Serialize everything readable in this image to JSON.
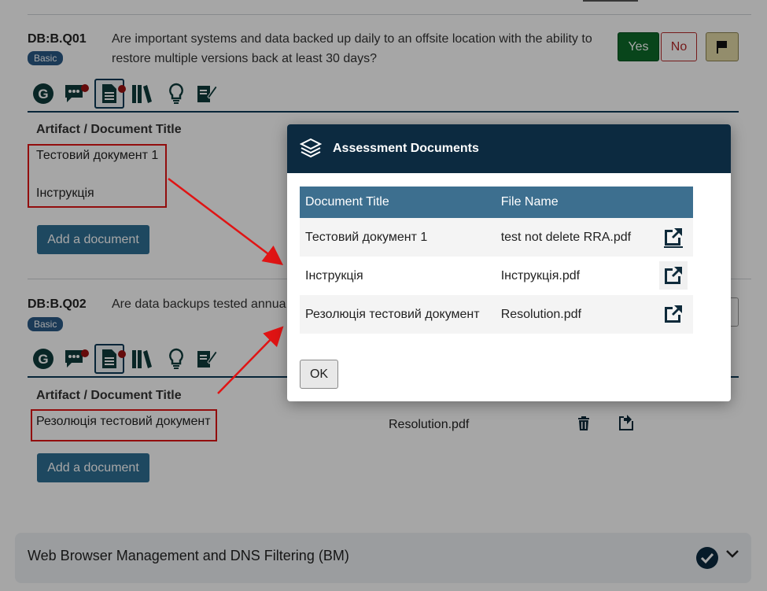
{
  "q1": {
    "id": "DB:B.Q01",
    "badge": "Basic",
    "text_line1": "Are important systems and data backed up daily to an offsite location with the ability to",
    "text_line2": "restore multiple versions back at least 30 days?",
    "yes_label": "Yes",
    "no_label": "No",
    "artifact_header": "Artifact / Document Title",
    "documents": [
      "Тестовий документ 1",
      "Інструкція"
    ],
    "add_label": "Add a document"
  },
  "q2": {
    "id": "DB:B.Q02",
    "badge": "Basic",
    "text": "Are data backups tested annua",
    "artifact_header": "Artifact / Document Title",
    "documents": [
      "Резолюція тестовий документ"
    ],
    "file_name": "Resolution.pdf",
    "add_label": "Add a document"
  },
  "toolbar_icons": [
    "guidance-icon",
    "comments-icon",
    "documents-icon",
    "references-icon",
    "hint-icon",
    "notes-icon"
  ],
  "accordion": {
    "title": "Web Browser Management and DNS Filtering (BM)"
  },
  "modal": {
    "title": "Assessment Documents",
    "columns": [
      "Document Title",
      "File Name"
    ],
    "rows": [
      {
        "title": "Тестовий документ 1",
        "file": "test not delete RRA.pdf"
      },
      {
        "title": "Інструкція",
        "file": "Інструкція.pdf"
      },
      {
        "title": "Резолюція тестовий документ",
        "file": "Resolution.pdf"
      }
    ],
    "ok_label": "OK"
  },
  "colors": {
    "header_dark": "#0c2a40",
    "table_header": "#3d6f8f",
    "yes_green": "#0d6b2a",
    "no_red": "#b52a2a",
    "annotation_red": "#e01414",
    "add_button": "#2e6f94"
  }
}
